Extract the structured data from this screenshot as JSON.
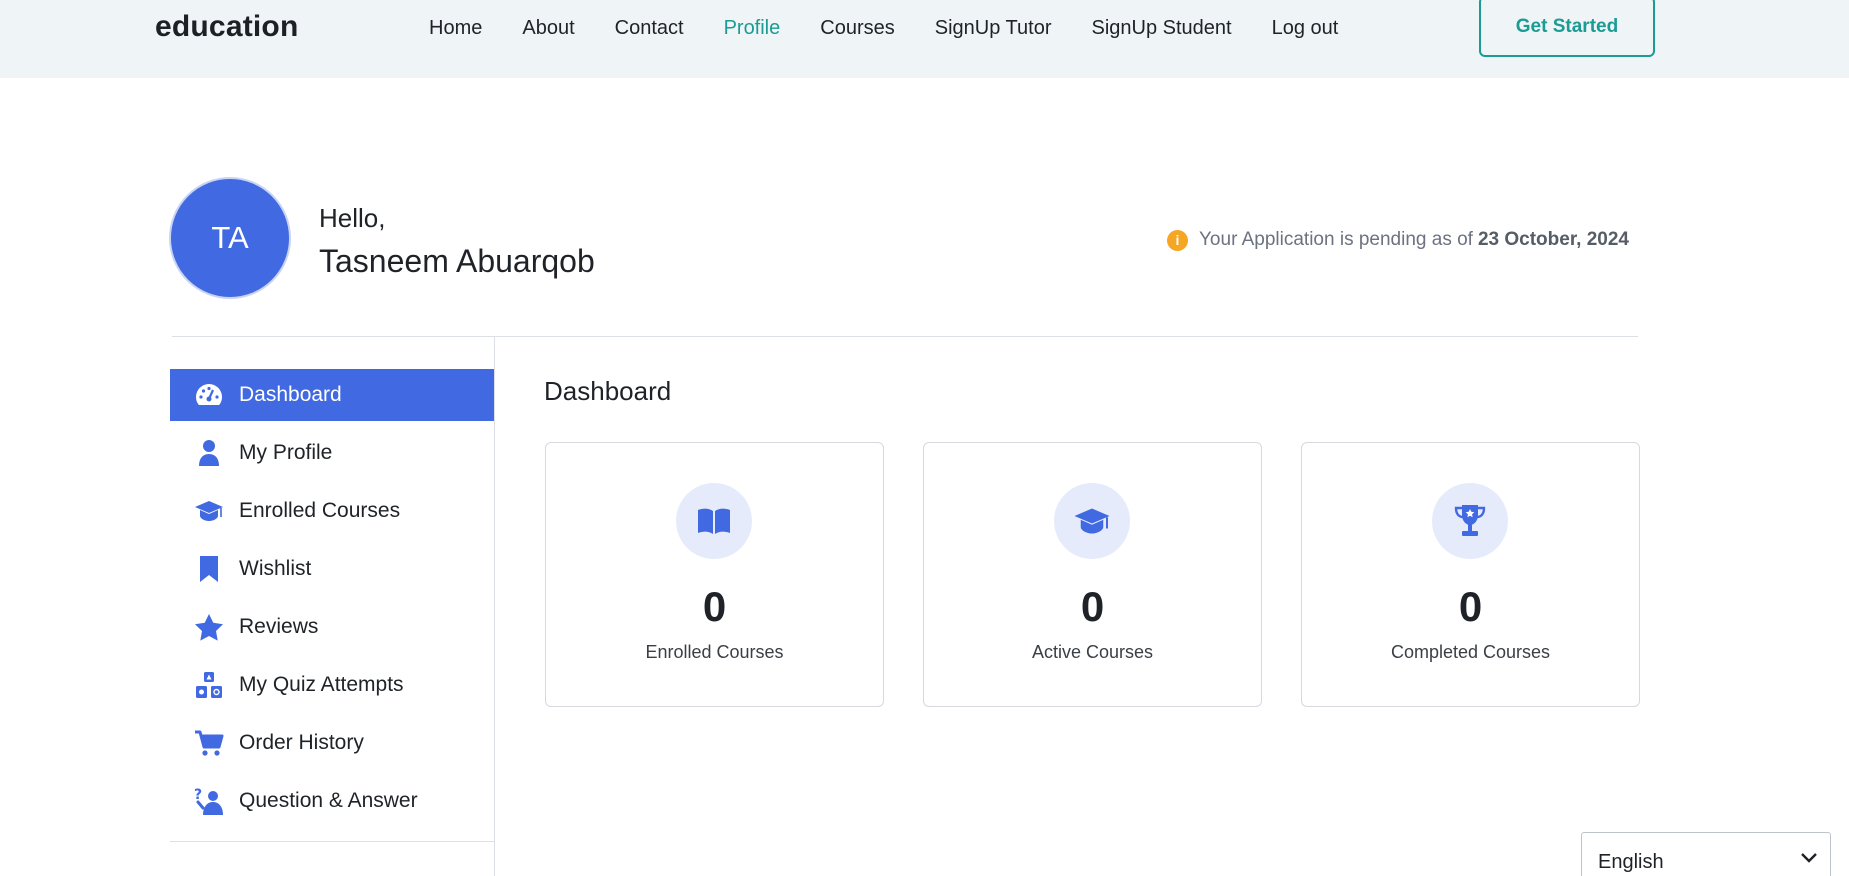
{
  "header": {
    "brand": "education",
    "nav": [
      "Home",
      "About",
      "Contact",
      "Profile",
      "Courses",
      "SignUp Tutor",
      "SignUp Student",
      "Log out"
    ],
    "active_nav": "Profile",
    "cta": "Get Started",
    "accent_color": "#1a9c95"
  },
  "profile": {
    "initials": "TA",
    "greeting": "Hello,",
    "name": "Tasneem Abuarqob",
    "avatar_color": "#4169e1",
    "status_text": "Your Application is pending as of",
    "status_date": "23 October, 2024",
    "status_icon": "info-icon"
  },
  "sidebar": {
    "items": [
      {
        "label": "Dashboard",
        "icon": "dashboard-gauge-icon",
        "active": true
      },
      {
        "label": "My Profile",
        "icon": "user-icon"
      },
      {
        "label": "Enrolled Courses",
        "icon": "graduation-cap-icon"
      },
      {
        "label": "Wishlist",
        "icon": "bookmark-icon"
      },
      {
        "label": "Reviews",
        "icon": "star-icon"
      },
      {
        "label": "My Quiz Attempts",
        "icon": "shapes-blocks-icon"
      },
      {
        "label": "Order History",
        "icon": "cart-icon"
      },
      {
        "label": "Question & Answer",
        "icon": "question-person-icon"
      }
    ],
    "active_color": "#4169e1"
  },
  "main": {
    "title": "Dashboard",
    "cards": [
      {
        "value": "0",
        "label": "Enrolled Courses",
        "icon": "book-open-icon"
      },
      {
        "value": "0",
        "label": "Active Courses",
        "icon": "graduation-cap-icon"
      },
      {
        "value": "0",
        "label": "Completed Courses",
        "icon": "trophy-icon"
      }
    ]
  },
  "language": {
    "selected": "English"
  }
}
